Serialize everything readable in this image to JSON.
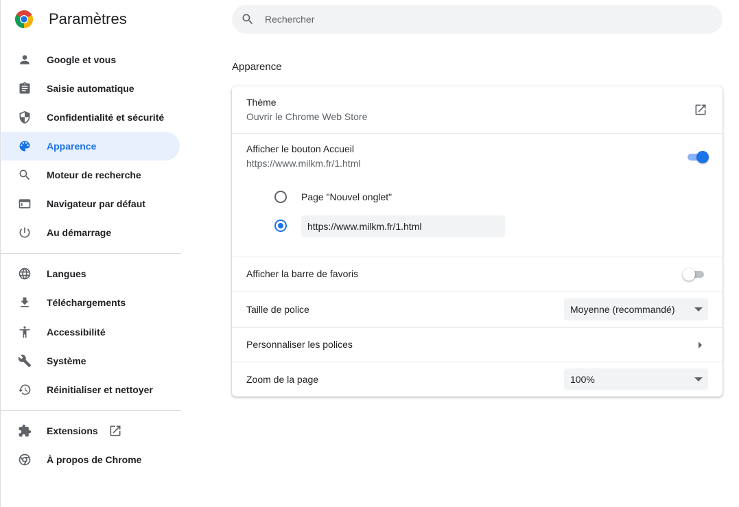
{
  "header": {
    "title": "Paramètres",
    "search_placeholder": "Rechercher",
    "logo_icon": "chrome-logo-icon"
  },
  "sidebar": {
    "items": [
      {
        "label": "Google et vous",
        "icon": "person-icon",
        "active": false
      },
      {
        "label": "Saisie automatique",
        "icon": "clipboard-icon",
        "active": false
      },
      {
        "label": "Confidentialité et sécurité",
        "icon": "shield-icon",
        "active": false
      },
      {
        "label": "Apparence",
        "icon": "palette-icon",
        "active": true
      },
      {
        "label": "Moteur de recherche",
        "icon": "search-icon",
        "active": false
      },
      {
        "label": "Navigateur par défaut",
        "icon": "browser-window-icon",
        "active": false
      },
      {
        "label": "Au démarrage",
        "icon": "power-icon",
        "active": false
      },
      {
        "label": "Langues",
        "icon": "globe-icon",
        "active": false
      },
      {
        "label": "Téléchargements",
        "icon": "download-icon",
        "active": false
      },
      {
        "label": "Accessibilité",
        "icon": "accessibility-icon",
        "active": false
      },
      {
        "label": "Système",
        "icon": "wrench-icon",
        "active": false
      },
      {
        "label": "Réinitialiser et nettoyer",
        "icon": "restore-icon",
        "active": false
      },
      {
        "label": "Extensions",
        "icon": "puzzle-icon",
        "active": false,
        "external": true
      },
      {
        "label": "À propos de Chrome",
        "icon": "chrome-icon",
        "active": false
      }
    ]
  },
  "main": {
    "section_title": "Apparence",
    "theme": {
      "label": "Thème",
      "sublabel": "Ouvrir le Chrome Web Store"
    },
    "home_button": {
      "label": "Afficher le bouton Accueil",
      "sublabel": "https://www.milkm.fr/1.html",
      "enabled": true,
      "options": {
        "new_tab_label": "Page \"Nouvel onglet\"",
        "custom_url_value": "https://www.milkm.fr/1.html",
        "selected": "custom"
      }
    },
    "bookmarks_bar": {
      "label": "Afficher la barre de favoris",
      "enabled": false
    },
    "font_size": {
      "label": "Taille de police",
      "value": "Moyenne (recommandé)"
    },
    "customize_fonts": {
      "label": "Personnaliser les polices"
    },
    "page_zoom": {
      "label": "Zoom de la page",
      "value": "100%"
    }
  },
  "colors": {
    "accent": "#1a73e8",
    "active_nav_bg": "#e8f0fe",
    "search_bg": "#f1f3f4",
    "text_secondary": "#5f6368"
  }
}
